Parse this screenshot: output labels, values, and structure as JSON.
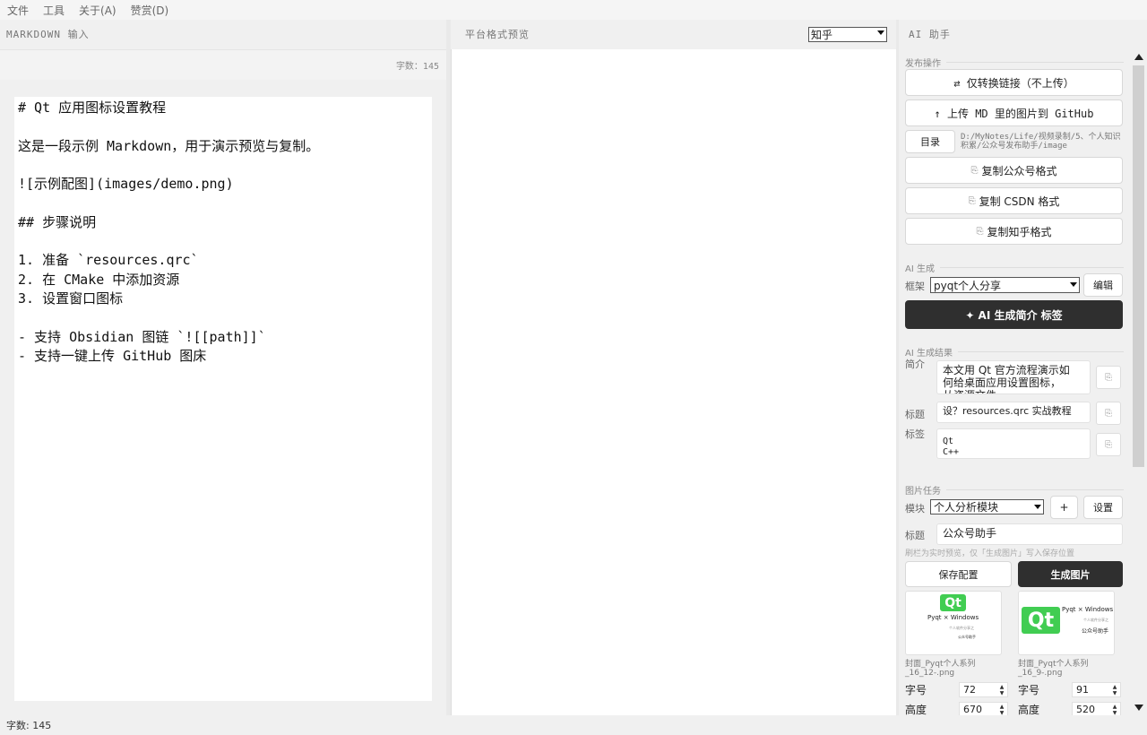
{
  "menu": [
    "文件",
    "工具",
    "关于(A)",
    "赞赏(D)"
  ],
  "left": {
    "title": "MARKDOWN 输入",
    "count": "字数：145",
    "editor_text": "# Qt 应用图标设置教程\n\n这是一段示例 Markdown，用于演示预览与复制。\n\n![示例配图](images/demo.png)\n\n## 步骤说明\n\n1. 准备 `resources.qrc`\n2. 在 CMake 中添加资源\n3. 设置窗口图标\n\n- 支持 Obsidian 图链 `![[path]]`\n- 支持一键上传 GitHub 图床"
  },
  "middle": {
    "title": "平台格式预览",
    "platform": "知乎"
  },
  "right": {
    "title": "AI 助手",
    "publish": {
      "section": "发布操作",
      "convert_links": "⇄ 仅转换链接（不上传）",
      "upload_github": "↑ 上传 MD 里的图片到 GitHub",
      "dir_button": "目录",
      "dir_path": "D:/MyNotes/Life/视频录制/5、个人知识积累/公众号发布助手/image",
      "copy_wechat": "复制公众号格式",
      "copy_csdn": "复制 CSDN 格式",
      "copy_zhihu": "复制知乎格式"
    },
    "ai": {
      "section": "AI 生成",
      "frame_label": "框架",
      "frame_value": "pyqt个人分享",
      "edit_button": "编辑",
      "generate_button": "✦ AI 生成简介  标签"
    },
    "result": {
      "section": "AI 生成结果",
      "intro_label": "简介",
      "intro_text": "本文用 Qt 官方流程演示如何给桌面应用设置图标，从资源文件",
      "title_label": "标题",
      "title_text": "设？resources.qrc 实战教程",
      "tags_label": "标签",
      "tags_text": "Qt\nC++"
    },
    "image": {
      "section": "图片任务",
      "module_label": "模块",
      "module_value": "个人分析模块",
      "add_button": "+",
      "settings_button": "设置",
      "title_label": "标题",
      "title_value": "公众号助手",
      "hint": "刷栏为实时预览，仅「生成图片」写入保存位置",
      "save_config": "保存配置",
      "generate_image": "生成图片",
      "thumbs": [
        {
          "qt": "Qt",
          "line1": "Pyqt × Windows",
          "line2": "个人软件分享之",
          "line3": "公众号助手",
          "caption": "封面_Pyqt个人系列_16_12-.png",
          "font_label": "字号",
          "font_value": "72",
          "height_label": "高度",
          "height_value": "670"
        },
        {
          "qt": "Qt",
          "line1": "Pyqt × Windows",
          "line2": "个人软件分享之",
          "line3": "公众号助手",
          "caption": "封面_Pyqt个人系列_16_9-.png",
          "font_label": "字号",
          "font_value": "91",
          "height_label": "高度",
          "height_value": "520"
        }
      ]
    }
  },
  "status": "字数: 145"
}
